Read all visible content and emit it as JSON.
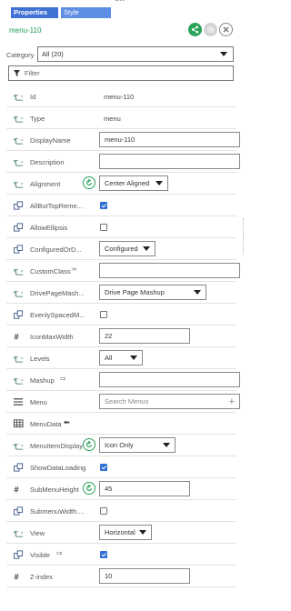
{
  "tabs": [
    {
      "label": "Properties"
    },
    {
      "label": "Style Properties"
    }
  ],
  "object_name": "menu-110",
  "category": {
    "label": "Category",
    "value": "All (20)"
  },
  "filter": {
    "placeholder": "Filter"
  },
  "properties": [
    {
      "name": "Id",
      "kind": "text",
      "value": "menu-110"
    },
    {
      "name": "Type",
      "kind": "text",
      "value": "menu"
    },
    {
      "name": "DisplayName",
      "kind": "input",
      "value": "menu-110"
    },
    {
      "name": "Description",
      "kind": "input",
      "value": ""
    },
    {
      "name": "Alignment",
      "kind": "select",
      "value": "Center Aligned",
      "reset": true
    },
    {
      "name": "AllButTopReme...",
      "kind": "checkbox",
      "checked": true
    },
    {
      "name": "AllowEllipsis",
      "kind": "checkbox",
      "checked": false
    },
    {
      "name": "ConfiguredOrD...",
      "kind": "select",
      "value": "Configured"
    },
    {
      "name": "CustomClass",
      "kind": "input",
      "value": ""
    },
    {
      "name": "DrivePageMash...",
      "kind": "select",
      "value": "Drive Page Mashup"
    },
    {
      "name": "EvenlySpacedM...",
      "kind": "checkbox",
      "checked": false
    },
    {
      "name": "IconMaxWidth",
      "kind": "input",
      "value": "22"
    },
    {
      "name": "Levels",
      "kind": "select",
      "value": "All"
    },
    {
      "name": "Mashup",
      "kind": "input",
      "value": ""
    },
    {
      "name": "Menu",
      "kind": "search",
      "placeholder": "Search Menus"
    },
    {
      "name": "MenuData",
      "kind": "none"
    },
    {
      "name": "MenuItemDisplay",
      "kind": "select",
      "value": "Icon Only",
      "reset": true
    },
    {
      "name": "ShowDataLoading",
      "kind": "checkbox",
      "checked": true
    },
    {
      "name": "SubMenuHeight",
      "kind": "input",
      "value": "45",
      "reset": true
    },
    {
      "name": "SubmenuWidth....",
      "kind": "checkbox",
      "checked": false
    },
    {
      "name": "View",
      "kind": "select",
      "value": "Horizontal"
    },
    {
      "name": "Visible",
      "kind": "checkbox",
      "checked": true
    },
    {
      "name": "Z-index",
      "kind": "input",
      "value": "10"
    }
  ],
  "colors": {
    "accent_green": "#2aa35a",
    "tab_blue": "#4072d6",
    "checkbox_blue": "#2f6fd6"
  }
}
